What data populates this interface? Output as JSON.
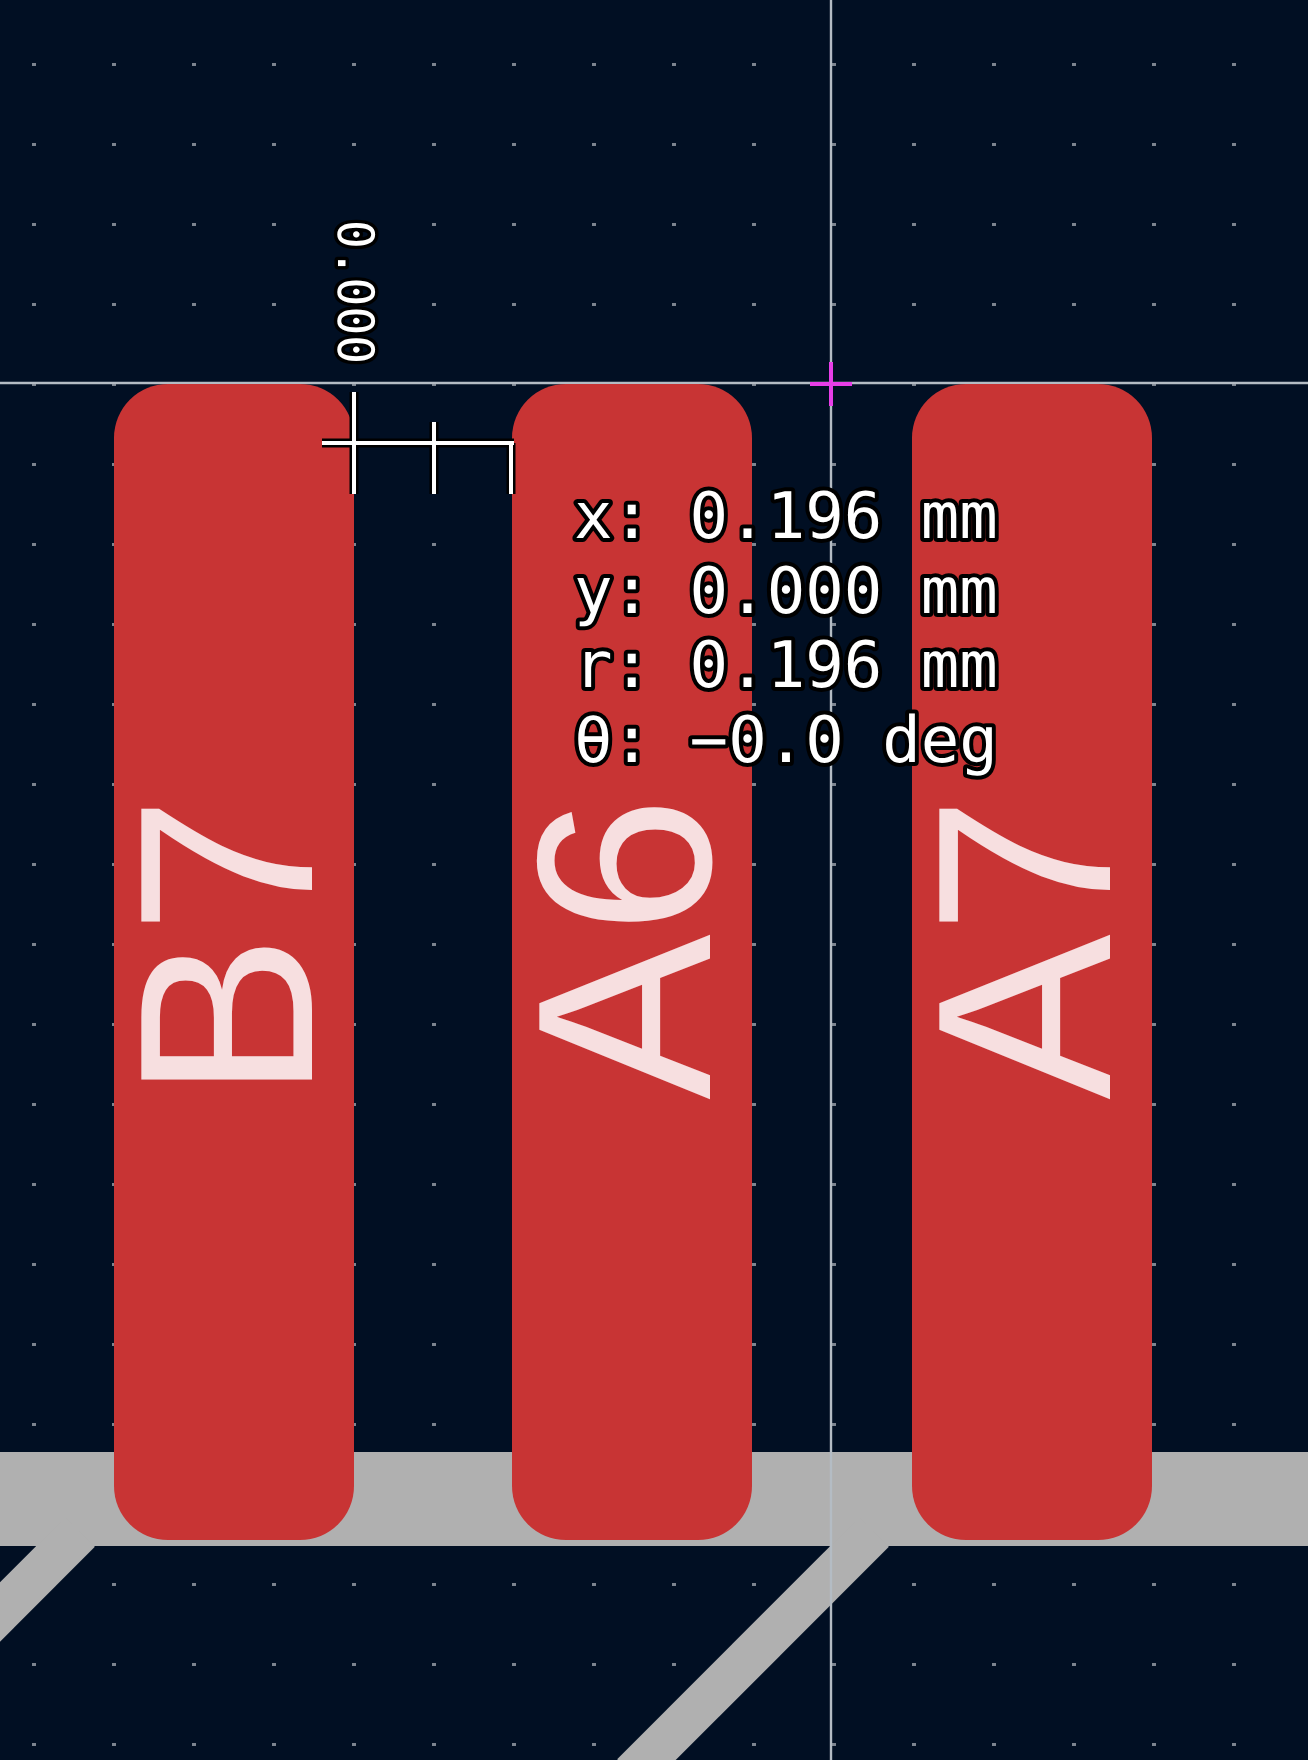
{
  "canvas": {
    "dimension": {
      "label": "0.000"
    },
    "pads": [
      {
        "label": "B7"
      },
      {
        "label": "A6"
      },
      {
        "label": "A7"
      }
    ],
    "readout": [
      "x: 0.196 mm",
      "y: 0.000 mm",
      "r: 0.196 mm",
      "θ: −0.0 deg"
    ]
  }
}
